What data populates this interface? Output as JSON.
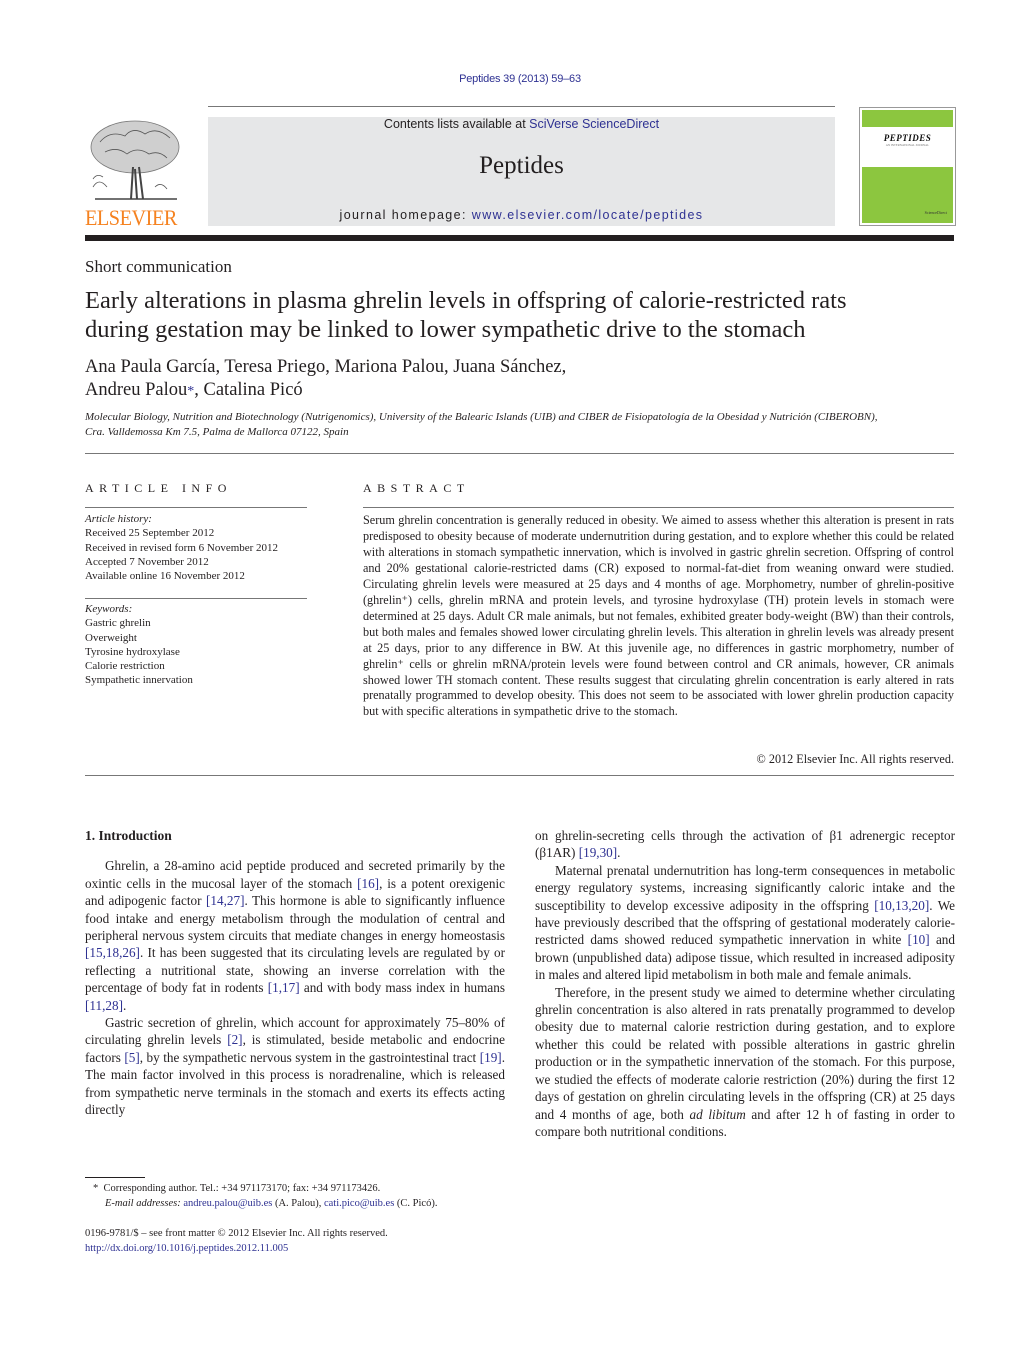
{
  "header": {
    "citation": "Peptides 39 (2013) 59–63",
    "contents_prefix": "Contents lists available at ",
    "contents_link": "SciVerse ScienceDirect",
    "journal_name": "Peptides",
    "homepage_prefix": "journal homepage: ",
    "homepage_link": "www.elsevier.com/locate/peptides",
    "publisher_logo_text": "ELSEVIER",
    "cover_title": "PEPTIDES",
    "cover_subtitle": "AN INTERNATIONAL JOURNAL",
    "cover_publisher": "ScienceDirect",
    "colors": {
      "link": "#2e3192",
      "elsevier_orange": "#f58220",
      "cover_green": "#8cc63f",
      "banner_gray": "#e6e7e8"
    }
  },
  "article": {
    "type": "Short communication",
    "title_line1": "Early alterations in plasma ghrelin levels in offspring of calorie-restricted rats",
    "title_line2": "during gestation may be linked to lower sympathetic drive to the stomach",
    "authors_line1": "Ana Paula García, Teresa Priego, Mariona Palou, Juana Sánchez,",
    "authors_line2a": "Andreu Palou",
    "authors_star": "*",
    "authors_line2b": ", Catalina Picó",
    "affiliation_line1": "Molecular Biology, Nutrition and Biotechnology (Nutrigenomics), University of the Balearic Islands (UIB) and CIBER de Fisiopatología de la Obesidad y Nutrición (CIBEROBN),",
    "affiliation_line2": "Cra. Valldemossa Km 7.5, Palma de Mallorca 07122, Spain"
  },
  "article_info": {
    "heading": "ARTICLE INFO",
    "history_label": "Article history:",
    "history": [
      "Received 25 September 2012",
      "Received in revised form 6 November 2012",
      "Accepted 7 November 2012",
      "Available online 16 November 2012"
    ],
    "keywords_label": "Keywords:",
    "keywords": [
      "Gastric ghrelin",
      "Overweight",
      "Tyrosine hydroxylase",
      "Calorie restriction",
      "Sympathetic innervation"
    ]
  },
  "abstract": {
    "heading": "ABSTRACT",
    "text": "Serum ghrelin concentration is generally reduced in obesity. We aimed to assess whether this alteration is present in rats predisposed to obesity because of moderate undernutrition during gestation, and to explore whether this could be related with alterations in stomach sympathetic innervation, which is involved in gastric ghrelin secretion. Offspring of control and 20% gestational calorie-restricted dams (CR) exposed to normal-fat-diet from weaning onward were studied. Circulating ghrelin levels were measured at 25 days and 4 months of age. Morphometry, number of ghrelin-positive (ghrelin⁺) cells, ghrelin mRNA and protein levels, and tyrosine hydroxylase (TH) protein levels in stomach were determined at 25 days. Adult CR male animals, but not females, exhibited greater body-weight (BW) than their controls, but both males and females showed lower circulating ghrelin levels. This alteration in ghrelin levels was already present at 25 days, prior to any difference in BW. At this juvenile age, no differences in gastric morphometry, number of ghrelin⁺ cells or ghrelin mRNA/protein levels were found between control and CR animals, however, CR animals showed lower TH stomach content. These results suggest that circulating ghrelin concentration is early altered in rats prenatally programmed to develop obesity. This does not seem to be associated with lower ghrelin production capacity but with specific alterations in sympathetic drive to the stomach.",
    "copyright": "© 2012 Elsevier Inc. All rights reserved."
  },
  "body": {
    "section_heading": "1.  Introduction",
    "p1": [
      {
        "t": "Ghrelin, a 28-amino acid peptide produced and secreted primarily by the oxintic cells in the mucosal layer of the stomach "
      },
      {
        "c": "[16]"
      },
      {
        "t": ", is a potent orexigenic and adipogenic factor "
      },
      {
        "c": "[14,27]"
      },
      {
        "t": ". This hormone is able to significantly influence food intake and energy metabolism through the modulation of central and peripheral nervous system circuits that mediate changes in energy homeostasis "
      },
      {
        "c": "[15,18,26]"
      },
      {
        "t": ". It has been suggested that its circulating levels are regulated by or reflecting a nutritional state, showing an inverse correlation with the percentage of body fat in rodents "
      },
      {
        "c": "[1,17]"
      },
      {
        "t": " and with body mass index in humans "
      },
      {
        "c": "[11,28]"
      },
      {
        "t": "."
      }
    ],
    "p2": [
      {
        "t": "Gastric secretion of ghrelin, which account for approximately 75–80% of circulating ghrelin levels "
      },
      {
        "c": "[2]"
      },
      {
        "t": ", is stimulated, beside metabolic and endocrine factors "
      },
      {
        "c": "[5]"
      },
      {
        "t": ", by the sympathetic nervous system in the gastrointestinal tract "
      },
      {
        "c": "[19]"
      },
      {
        "t": ". The main factor involved in this process is noradrenaline, which is released from sympathetic nerve terminals in the stomach and exerts its effects acting directly"
      }
    ],
    "p2_cont": [
      {
        "t": "on ghrelin-secreting cells through the activation of β1 adrenergic receptor (β1AR) "
      },
      {
        "c": "[19,30]"
      },
      {
        "t": "."
      }
    ],
    "p3": [
      {
        "t": "Maternal prenatal undernutrition has long-term consequences in metabolic energy regulatory systems, increasing significantly caloric intake and the susceptibility to develop excessive adiposity in the offspring "
      },
      {
        "c": "[10,13,20]"
      },
      {
        "t": ". We have previously described that the offspring of gestational moderately calorie-restricted dams showed reduced sympathetic innervation in white "
      },
      {
        "c": "[10]"
      },
      {
        "t": " and brown (unpublished data) adipose tissue, which resulted in increased adiposity in males and altered lipid metabolism in both male and female animals."
      }
    ],
    "p4": [
      {
        "t": "Therefore, in the present study we aimed to determine whether circulating ghrelin concentration is also altered in rats prenatally programmed to develop obesity due to maternal calorie restriction during gestation, and to explore whether this could be related with possible alterations in gastric ghrelin production or in the sympathetic innervation of the stomach. For this purpose, we studied the effects of moderate calorie restriction (20%) during the first 12 days of gestation on ghrelin circulating levels in the offspring (CR) at 25 days and 4 months of age, both "
      },
      {
        "i": "ad libitum"
      },
      {
        "t": " and after 12 h of fasting in order to compare both nutritional conditions."
      }
    ]
  },
  "footnotes": {
    "star": "*",
    "corresponding": "Corresponding author. Tel.: +34 971173170; fax: +34 971173426.",
    "email_label": "E-mail addresses: ",
    "email1": "andreu.palou@uib.es",
    "email1_name": " (A. Palou), ",
    "email2": "cati.pico@uib.es",
    "email2_name": " (C. Picó).",
    "front_matter": "0196-9781/$ – see front matter © 2012 Elsevier Inc. All rights reserved.",
    "doi": "http://dx.doi.org/10.1016/j.peptides.2012.11.005"
  }
}
